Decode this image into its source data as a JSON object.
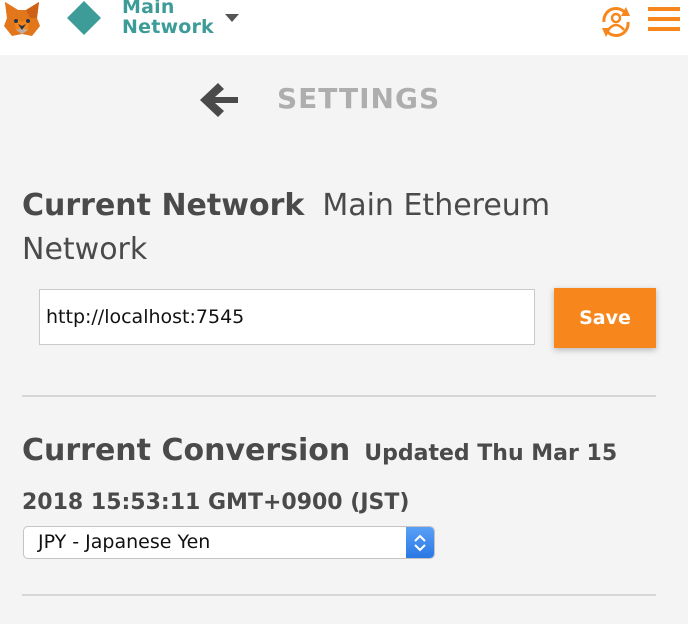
{
  "header": {
    "network_label": "Main Network",
    "icons": {
      "logo": "fox-logo-icon",
      "network": "diamond-icon",
      "dropdown": "chevron-down-icon",
      "account": "account-sync-icon",
      "menu": "hamburger-menu-icon"
    },
    "colors": {
      "network": "#3e9c98",
      "accent": "#f7861c"
    }
  },
  "settings": {
    "title": "SETTINGS",
    "back_icon": "arrow-left-icon",
    "current_network": {
      "label": "Current Network",
      "value": "Main Ethereum Network",
      "rpc_url": "http://localhost:7545",
      "save_label": "Save"
    },
    "current_conversion": {
      "label": "Current Conversion",
      "updated_text": "Updated Thu Mar 15 2018 15:53:11 GMT+0900 (JST)",
      "selected_currency": "JPY - Japanese Yen"
    }
  }
}
